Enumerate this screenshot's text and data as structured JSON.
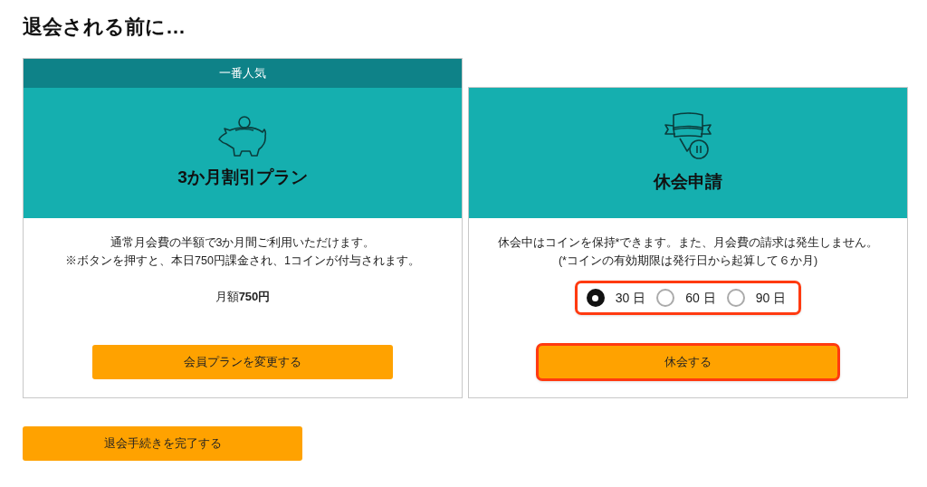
{
  "heading": "退会される前に…",
  "cards": [
    {
      "kind": "plan",
      "badge": "一番人気",
      "title": "3か月割引プラン",
      "description": [
        "通常月会費の半額で3か月間ご利用いただけます。",
        "※ボタンを押すと、本日750円課金され、1コインが付与されます。"
      ],
      "price": "月額**750円**",
      "button": {
        "label": "会員プランを変更する",
        "highlighted": false
      }
    },
    {
      "kind": "pause",
      "title": "休会申請",
      "description": [
        "休会中はコインを保持*できます。また、月会費の請求は発生しません。",
        "(*コインの有効期限は発行日から起算して６か月)"
      ],
      "options": {
        "highlighted": true,
        "items": [
          {
            "label": "30 日",
            "selected": true
          },
          {
            "label": "60 日",
            "selected": false
          },
          {
            "label": "90 日",
            "selected": false
          }
        ]
      },
      "button": {
        "label": "休会する",
        "highlighted": true
      }
    }
  ],
  "footer_button": "退会手続きを完了する"
}
